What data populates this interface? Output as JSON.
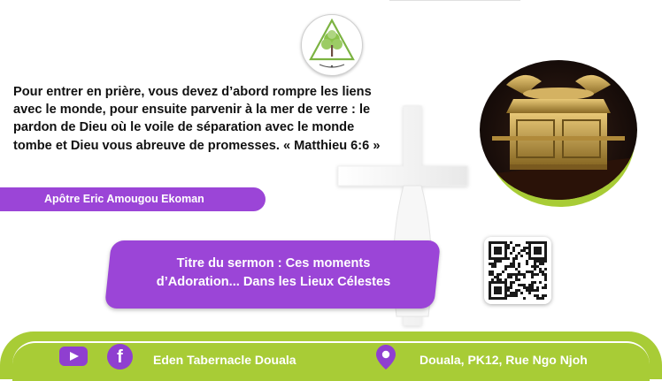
{
  "quote": {
    "text": "Pour entrer en prière, vous devez d’abord rompre les liens avec le monde, pour ensuite parvenir à la mer de verre : le pardon de Dieu où le voile de séparation avec le monde tombe et Dieu vous abreuve de promesses. « Matthieu 6:6 »"
  },
  "author": {
    "name": "Apôtre Eric Amougou Ekoman"
  },
  "sermon": {
    "line1": "Titre du sermon : Ces moments",
    "line2": "d’Adoration... Dans les Lieux Célestes"
  },
  "footer": {
    "church_name": "Eden Tabernacle Douala",
    "address": "Douala, PK12, Rue Ngo Njoh"
  },
  "icons": {
    "youtube": "youtube-icon",
    "facebook": "facebook-icon",
    "location": "location-pin-icon",
    "qr": "qr-code-icon",
    "logo": "church-logo-icon",
    "cross": "cross-icon"
  },
  "colors": {
    "purple": "#9b45d7",
    "green": "#a8cc36",
    "gold": "#c9a24a"
  }
}
